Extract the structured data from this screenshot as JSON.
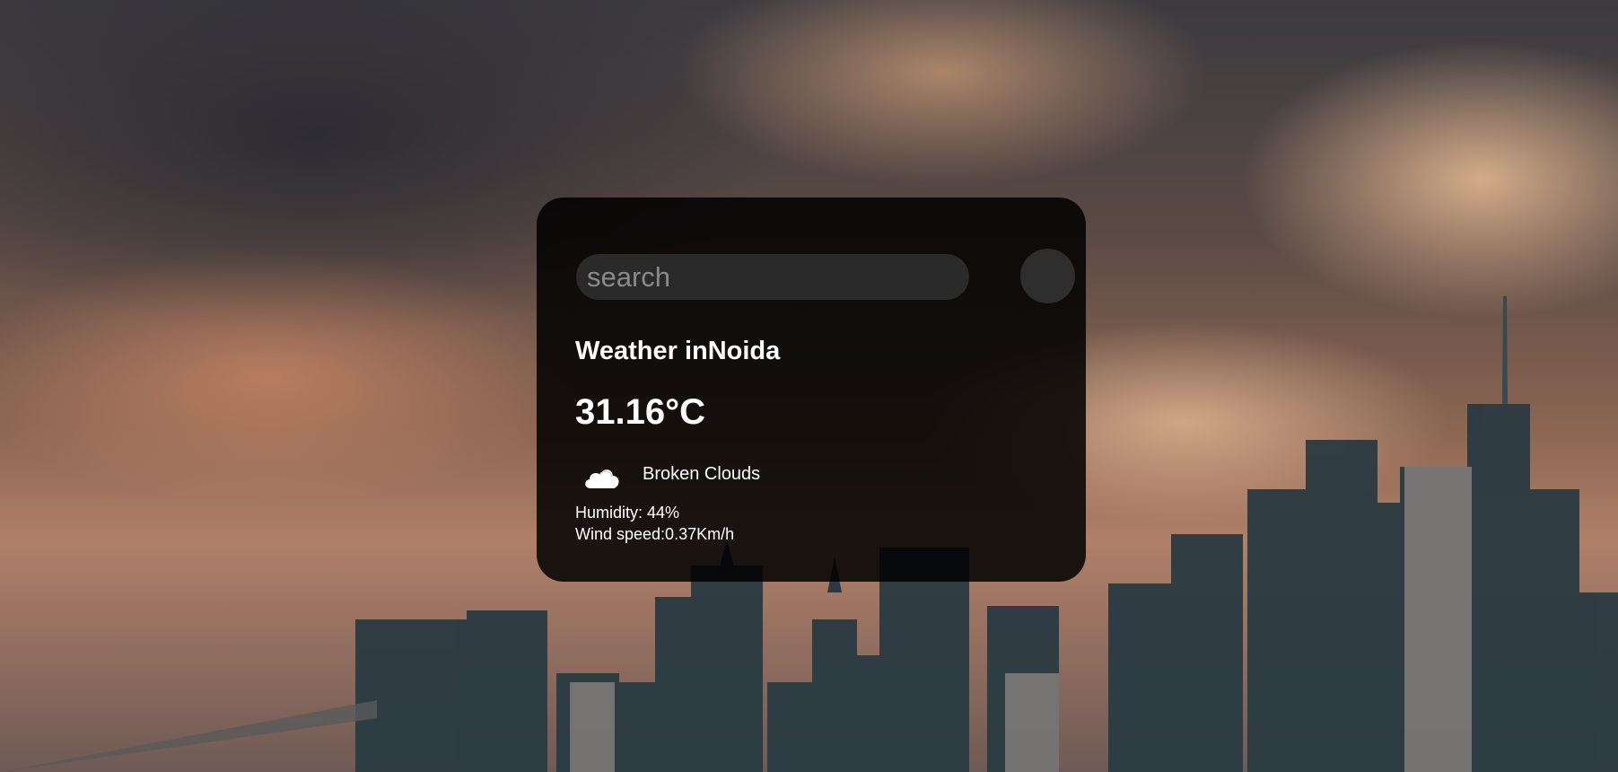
{
  "search": {
    "placeholder": "search",
    "value": ""
  },
  "weather": {
    "title": "Weather inNoida",
    "temperature": "31.16°C",
    "condition": "Broken Clouds",
    "condition_icon": "cloud-icon",
    "humidity": "Humidity: 44%",
    "wind": "Wind speed:0.37Km/h"
  },
  "colors": {
    "card_background": "#000000",
    "text": "#ffffff",
    "search_field": "#2a2a2a",
    "search_button": "#2e2e2e"
  }
}
